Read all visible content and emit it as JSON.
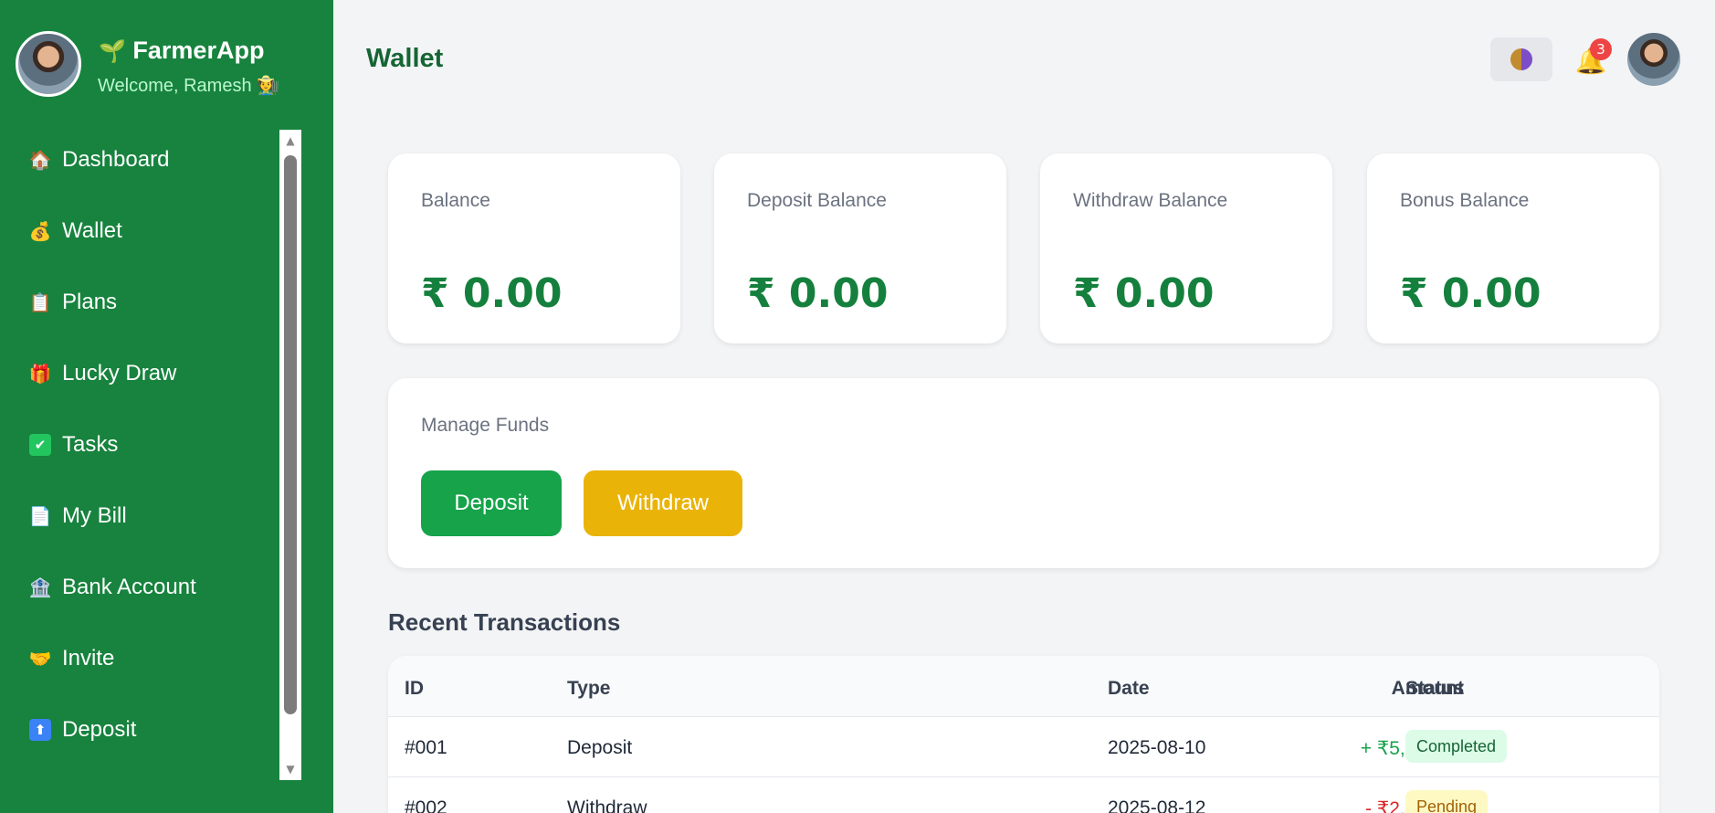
{
  "app": {
    "name": "FarmerApp",
    "welcome": "Welcome, Ramesh 🧑‍🌾",
    "brand_icon": "seedling-icon"
  },
  "sidebar": {
    "items": [
      {
        "label": "Dashboard",
        "icon": "🏠"
      },
      {
        "label": "Wallet",
        "icon": "💰"
      },
      {
        "label": "Plans",
        "icon": "📋"
      },
      {
        "label": "Lucky Draw",
        "icon": "🎁"
      },
      {
        "label": "Tasks",
        "icon": "✔"
      },
      {
        "label": "My Bill",
        "icon": "📄"
      },
      {
        "label": "Bank Account",
        "icon": "🏦"
      },
      {
        "label": "Invite",
        "icon": "🤝"
      },
      {
        "label": "Deposit",
        "icon": "⬆"
      }
    ]
  },
  "header": {
    "title": "Wallet",
    "notifications_count": "3"
  },
  "balances": [
    {
      "label": "Balance",
      "value": "₹ 0.00"
    },
    {
      "label": "Deposit Balance",
      "value": "₹ 0.00"
    },
    {
      "label": "Withdraw Balance",
      "value": "₹ 0.00"
    },
    {
      "label": "Bonus Balance",
      "value": "₹ 0.00"
    }
  ],
  "funds": {
    "label": "Manage Funds",
    "deposit_label": "Deposit",
    "withdraw_label": "Withdraw"
  },
  "transactions": {
    "title": "Recent Transactions",
    "columns": [
      "ID",
      "Type",
      "Amount",
      "Date",
      "Status"
    ],
    "rows": [
      {
        "id": "#001",
        "type": "Deposit",
        "amount": "+ ₹5,000.00",
        "date": "2025-08-10",
        "status": "Completed"
      },
      {
        "id": "#002",
        "type": "Withdraw",
        "amount": "- ₹2,000.00",
        "date": "2025-08-12",
        "status": "Pending"
      }
    ]
  },
  "colors": {
    "sidebar": "#17833e",
    "accent": "#15803d",
    "deposit_button": "#16a34a",
    "withdraw_button": "#eab308"
  }
}
